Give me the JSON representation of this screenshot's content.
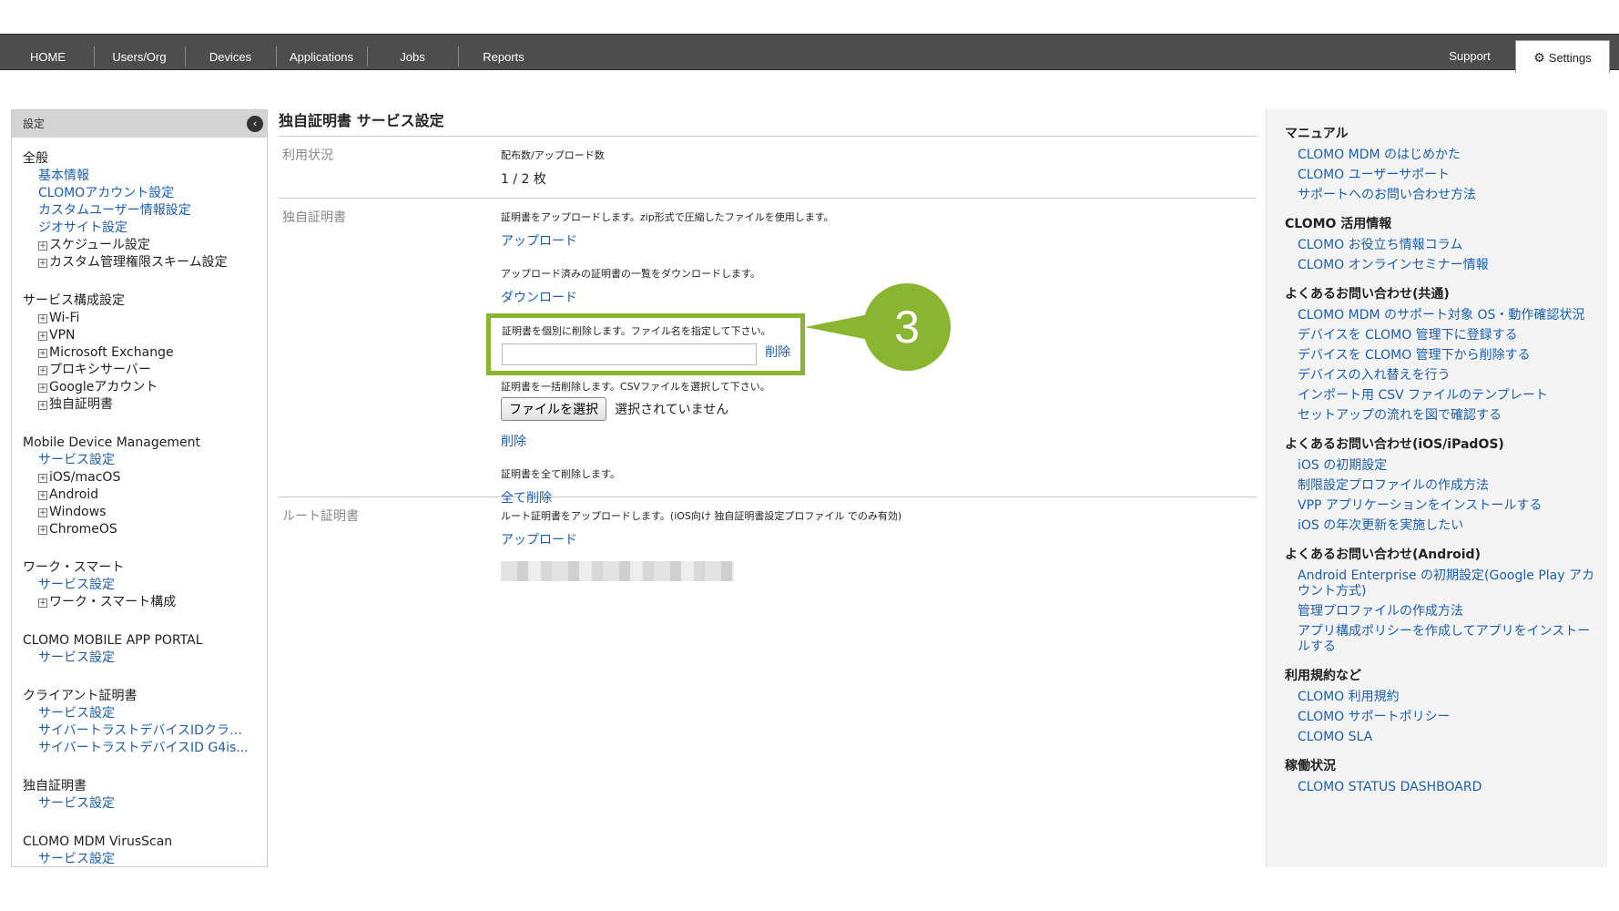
{
  "nav": {
    "items": [
      "HOME",
      "Users/Org",
      "Devices",
      "Applications",
      "Jobs",
      "Reports"
    ],
    "support": "Support",
    "settings": "Settings"
  },
  "sidebar": {
    "header": "設定",
    "groups": [
      {
        "title": "全般",
        "items": [
          {
            "type": "link",
            "label": "基本情報"
          },
          {
            "type": "link",
            "label": "CLOMOアカウント設定"
          },
          {
            "type": "link",
            "label": "カスタムユーザー情報設定"
          },
          {
            "type": "link",
            "label": "ジオサイト設定"
          },
          {
            "type": "expand",
            "label": "スケジュール設定"
          },
          {
            "type": "expand",
            "label": "カスタム管理権限スキーム設定"
          }
        ]
      },
      {
        "title": "サービス構成設定",
        "items": [
          {
            "type": "expand",
            "label": "Wi-Fi"
          },
          {
            "type": "expand",
            "label": "VPN"
          },
          {
            "type": "expand",
            "label": "Microsoft Exchange"
          },
          {
            "type": "expand",
            "label": "プロキシサーバー"
          },
          {
            "type": "expand",
            "label": "Googleアカウント"
          },
          {
            "type": "expand",
            "label": "独自証明書"
          }
        ]
      },
      {
        "title": "Mobile Device Management",
        "items": [
          {
            "type": "link",
            "label": "サービス設定"
          },
          {
            "type": "expand",
            "label": "iOS/macOS"
          },
          {
            "type": "expand",
            "label": "Android"
          },
          {
            "type": "expand",
            "label": "Windows"
          },
          {
            "type": "expand",
            "label": "ChromeOS"
          }
        ]
      },
      {
        "title": "ワーク・スマート",
        "items": [
          {
            "type": "link",
            "label": "サービス設定"
          },
          {
            "type": "expand",
            "label": "ワーク・スマート構成"
          }
        ]
      },
      {
        "title": "CLOMO MOBILE APP PORTAL",
        "items": [
          {
            "type": "link",
            "label": "サービス設定"
          }
        ]
      },
      {
        "title": "クライアント証明書",
        "items": [
          {
            "type": "link",
            "label": "サービス設定"
          },
          {
            "type": "link",
            "label": "サイバートラストデバイスIDクライ..."
          },
          {
            "type": "link",
            "label": "サイバートラストデバイスID G4is..."
          }
        ]
      },
      {
        "title": "独自証明書",
        "items": [
          {
            "type": "link",
            "label": "サービス設定"
          }
        ]
      },
      {
        "title": "CLOMO MDM VirusScan",
        "items": [
          {
            "type": "link",
            "label": "サービス設定"
          }
        ]
      }
    ]
  },
  "main": {
    "title": "独自証明書 サービス設定",
    "usage": {
      "label": "利用状況",
      "sublabel": "配布数/アップロード数",
      "value": "1 / 2 枚"
    },
    "cert": {
      "label": "独自証明書",
      "upload_desc": "証明書をアップロードします。zip形式で圧縮したファイルを使用します。",
      "upload_link": "アップロード",
      "download_desc": "アップロード済みの証明書の一覧をダウンロードします。",
      "download_link": "ダウンロード",
      "individual_desc": "証明書を個別に削除します。ファイル名を指定して下さい。",
      "file_name_value": "",
      "individual_delete": "削除",
      "bulk_desc": "証明書を一括削除します。CSVファイルを選択して下さい。",
      "choose_file": "ファイルを選択",
      "no_file": "選択されていません",
      "bulk_delete": "削除",
      "all_desc": "証明書を全て削除します。",
      "all_delete": "全て削除"
    },
    "root": {
      "label": "ルート証明書",
      "desc": "ルート証明書をアップロードします。(iOS向け 独自証明書設定プロファイル でのみ有効)",
      "upload_link": "アップロード"
    },
    "callout": "3"
  },
  "rightbar": {
    "sections": [
      {
        "title": "マニュアル",
        "links": [
          "CLOMO MDM のはじめかた",
          "CLOMO ユーザーサポート",
          "サポートへのお問い合わせ方法"
        ]
      },
      {
        "title": "CLOMO 活用情報",
        "links": [
          "CLOMO お役立ち情報コラム",
          "CLOMO オンラインセミナー情報"
        ]
      },
      {
        "title": "よくあるお問い合わせ(共通)",
        "links": [
          "CLOMO MDM のサポート対象 OS・動作確認状況",
          "デバイスを CLOMO 管理下に登録する",
          "デバイスを CLOMO 管理下から削除する",
          "デバイスの入れ替えを行う",
          "インポート用 CSV ファイルのテンプレート",
          "セットアップの流れを図で確認する"
        ]
      },
      {
        "title": "よくあるお問い合わせ(iOS/iPadOS)",
        "links": [
          "iOS の初期設定",
          "制限設定プロファイルの作成方法",
          "VPP アプリケーションをインストールする",
          "iOS の年次更新を実施したい"
        ]
      },
      {
        "title": "よくあるお問い合わせ(Android)",
        "links": [
          "Android Enterprise の初期設定(Google Play アカウント方式)",
          "管理プロファイルの作成方法",
          "アプリ構成ポリシーを作成してアプリをインストールする"
        ]
      },
      {
        "title": "利用規約など",
        "links": [
          "CLOMO 利用規約",
          "CLOMO サポートポリシー",
          "CLOMO SLA"
        ]
      },
      {
        "title": "稼働状況",
        "links": [
          "CLOMO STATUS DASHBOARD"
        ]
      }
    ]
  }
}
